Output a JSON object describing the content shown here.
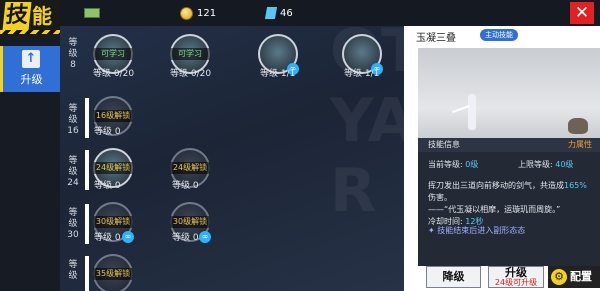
{
  "header": {
    "title": "技能",
    "resources": [
      {
        "icon": "cash-icon",
        "value": ""
      },
      {
        "icon": "gold-coin-icon",
        "value": "121"
      },
      {
        "icon": "diamond-icon",
        "value": "46"
      }
    ]
  },
  "sidebar": {
    "tab_label": "升级"
  },
  "tree": {
    "rows": [
      {
        "label": "等级\n8"
      },
      {
        "label": "等级\n16"
      },
      {
        "label": "等级\n24"
      },
      {
        "label": "等级\n30"
      },
      {
        "label": "等级"
      }
    ],
    "nodes": [
      {
        "caption": "可学习",
        "level": "等级 0/20"
      },
      {
        "caption": "可学习",
        "level": "等级 0/20"
      },
      {
        "caption": "",
        "level": "等级 1/1"
      },
      {
        "caption": "",
        "level": "等级 1/1"
      },
      {
        "caption": "16级解锁",
        "level": "等级 0"
      },
      {
        "caption": "24级解锁",
        "level": "等级 0"
      },
      {
        "caption": "24级解锁",
        "level": "等级 0"
      },
      {
        "caption": "30级解锁",
        "level": "等级 0"
      },
      {
        "caption": "30级解锁",
        "level": "等级 0"
      },
      {
        "caption": "35级解锁",
        "level": ""
      }
    ]
  },
  "panel": {
    "skill_name": "玉凝三叠",
    "skill_tag": "主动技能",
    "info_title": "技能信息",
    "attribute": "力属性",
    "current_level_label": "当前等级:",
    "current_level_value": "0级",
    "max_level_label": "上限等级:",
    "max_level_value": "40级",
    "description_a": "挥刀发出三道向前移动的剑气，共造成",
    "description_pct": "165%",
    "description_b": "伤害。",
    "quote": "——“代玉凝以相摩，运璇玑而周旋。”",
    "cooldown_label": "冷却时间:",
    "cooldown_value": "12秒",
    "note": "技能结束后进入副形态态",
    "downgrade_label": "降级",
    "upgrade_label": "升级",
    "upgrade_sub": "24级可升级",
    "config_label": "配置"
  }
}
